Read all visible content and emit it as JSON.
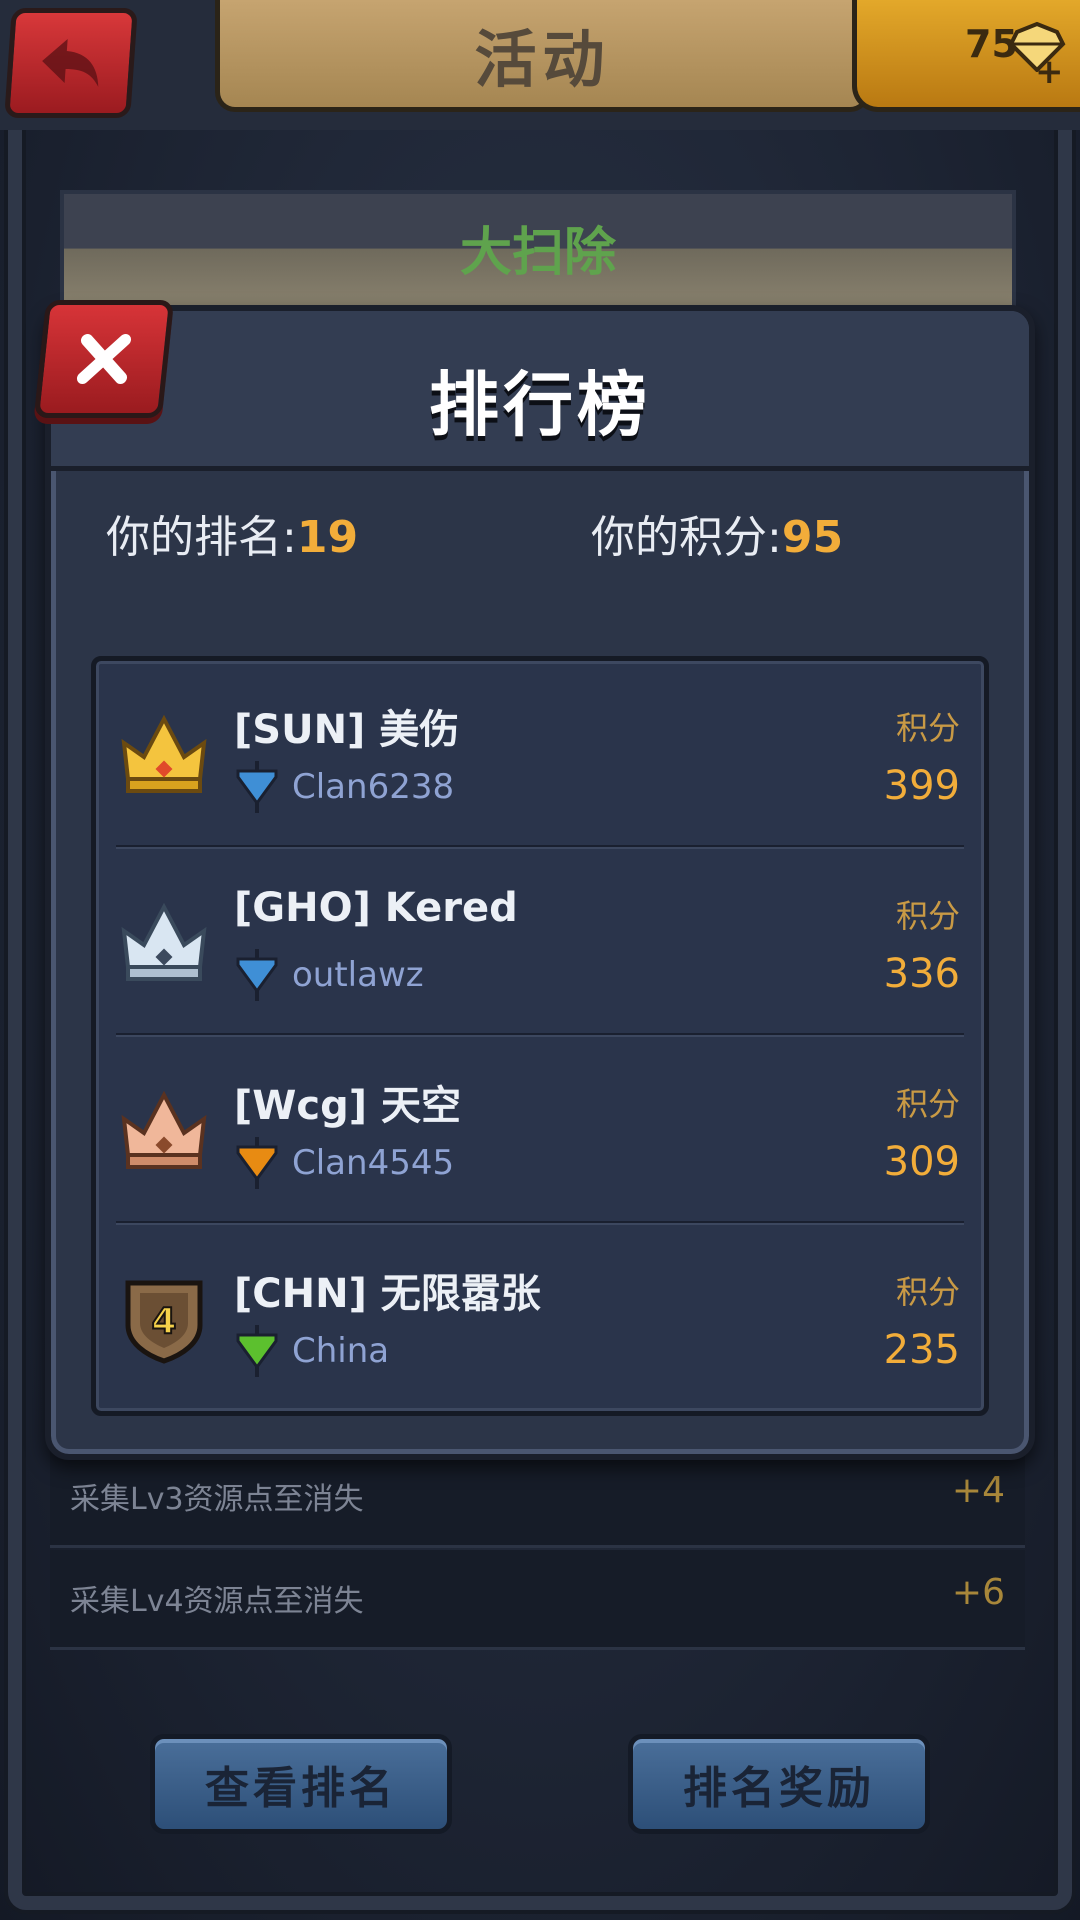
{
  "header": {
    "title": "活动",
    "gem_count": "75",
    "gem_plus": "+"
  },
  "event": {
    "title": "大扫除"
  },
  "tasks": [
    {
      "label": "采集Lv3资源点至消失",
      "value": "+4"
    },
    {
      "label": "采集Lv4资源点至消失",
      "value": "+6"
    }
  ],
  "buttons": {
    "view_rank": "查看排名",
    "rank_reward": "排名奖励"
  },
  "leaderboard": {
    "title": "排行榜",
    "my_rank_label": "你的排名:",
    "my_rank": "19",
    "my_score_label": "你的积分:",
    "my_score": "95",
    "entries": [
      {
        "rank": "1",
        "name": "[SUN] 美伤",
        "clan": "Clan6238",
        "score_label": "积分",
        "score": "399",
        "flag_color": "#3f8fd6",
        "icon": "gold-crown-icon"
      },
      {
        "rank": "2",
        "name": "[GHO] Kered",
        "clan": "outlawz",
        "score_label": "积分",
        "score": "336",
        "flag_color": "#3f8fd6",
        "icon": "silver-crown-icon"
      },
      {
        "rank": "3",
        "name": "[Wcg] 天空",
        "clan": "Clan4545",
        "score_label": "积分",
        "score": "309",
        "flag_color": "#e88b12",
        "icon": "bronze-crown-icon"
      },
      {
        "rank": "4",
        "name": "[CHN] 无限嚣张",
        "clan": "China",
        "score_label": "积分",
        "score": "235",
        "flag_color": "#5cc02e",
        "icon": "rank-shield-icon"
      }
    ]
  },
  "colors": {
    "accent_orange": "#f2ad3a",
    "clan_text": "#8fa3d3",
    "close_red": "#d73438",
    "button_blue": "#4a6f9a"
  }
}
